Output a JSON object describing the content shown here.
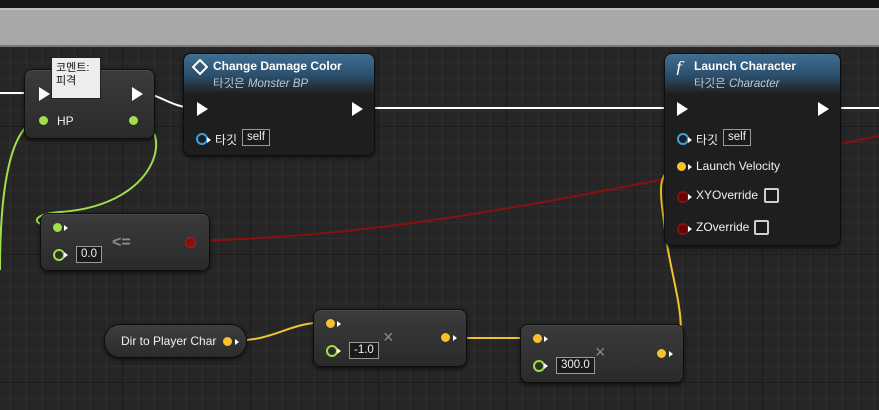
{
  "colors": {
    "exec": "#ffffff",
    "bool": "#8a1010",
    "float": "#9fe04a",
    "vector": "#f5c22c",
    "object": "#3aa0e8",
    "header_blue": "#2b4e6a"
  },
  "nodes": {
    "set_hp": {
      "tooltip": "코멘트: 피격",
      "tooltip_line1": "코멘트:",
      "tooltip_line2": "피격",
      "pin_label": "HP"
    },
    "change_damage_color": {
      "title": "Change Damage Color",
      "subtitle_prefix": "타깃은",
      "subtitle_target": "Monster BP",
      "target_label": "타깃",
      "target_value": "self",
      "icon": "event-diamond-icon"
    },
    "launch_character": {
      "title": "Launch Character",
      "subtitle_prefix": "타깃은",
      "subtitle_target": "Character",
      "target_label": "타깃",
      "target_value": "self",
      "launch_velocity_label": "Launch Velocity",
      "xy_override_label": "XYOverride",
      "z_override_label": "ZOverride",
      "icon": "function-icon"
    },
    "less_equal": {
      "operator": "<=",
      "value": "0.0"
    },
    "get_dir": {
      "label": "Dir to Player Char"
    },
    "multiply_1": {
      "value": "-1.0",
      "operator": "×"
    },
    "multiply_2": {
      "value": "300.0",
      "operator": "×"
    }
  }
}
